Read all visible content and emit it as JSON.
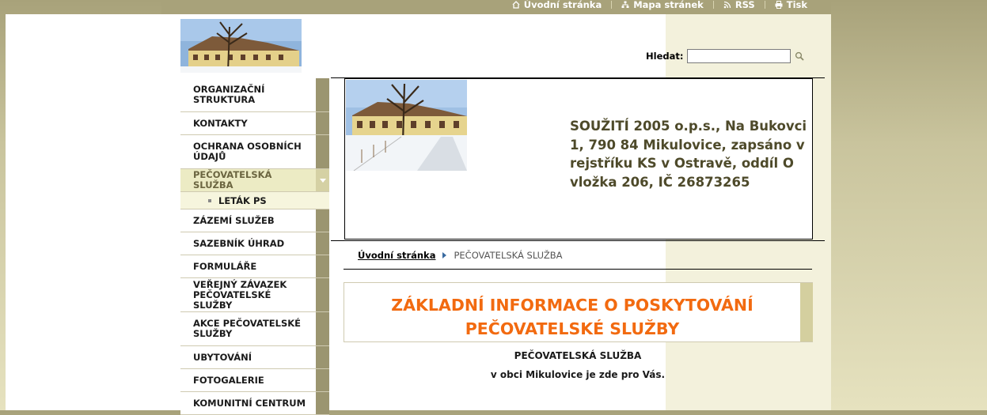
{
  "toplinks": [
    {
      "label": "Úvodní stránka",
      "icon": "home-icon"
    },
    {
      "label": "Mapa stránek",
      "icon": "sitemap-icon"
    },
    {
      "label": "RSS",
      "icon": "rss-icon"
    },
    {
      "label": "Tisk",
      "icon": "print-icon"
    }
  ],
  "search": {
    "label": "Hledat:",
    "value": "",
    "placeholder": ""
  },
  "nav": {
    "items": [
      {
        "label": "ORGANIZAČNÍ STRUKTURA"
      },
      {
        "label": "KONTAKTY"
      },
      {
        "label": "OCHRANA OSOBNÍCH ÚDAJŮ"
      },
      {
        "label": "PEČOVATELSKÁ SLUŽBA"
      },
      {
        "label": "LETÁK PS"
      },
      {
        "label": "ZÁZEMÍ SLUŽEB"
      },
      {
        "label": "SAZEBNÍK ÚHRAD"
      },
      {
        "label": "FORMULÁŘE"
      },
      {
        "label": "VEŘEJNÝ ZÁVAZEK PEČOVATELSKÉ SLUŽBY"
      },
      {
        "label": "AKCE PEČOVATELSKÉ SLUŽBY"
      },
      {
        "label": "UBYTOVÁNÍ"
      },
      {
        "label": "FOTOGALERIE"
      },
      {
        "label": "KOMUNITNÍ CENTRUM"
      }
    ]
  },
  "header": {
    "company": "SOUŽITÍ 2005 o.p.s., Na Bukovci 1, 790 84 Mikulovice, zapsáno v rejstříku KS v Ostravě, oddíl O vložka 206, IČ 26873265"
  },
  "breadcrumb": {
    "home": "Úvodní stránka",
    "current": "PEČOVATELSKÁ SLUŽBA"
  },
  "content": {
    "title": "ZÁKLADNÍ INFORMACE O POSKYTOVÁNÍ PEČOVATELSKÉ SLUŽBY",
    "p1": "PEČOVATELSKÁ SLUŽBA",
    "p2": "v obci Mikulovice je zde pro Vás."
  },
  "colors": {
    "accent": "#f26a10",
    "olive": "#9b9570",
    "text_olive": "#4e4a2a"
  }
}
